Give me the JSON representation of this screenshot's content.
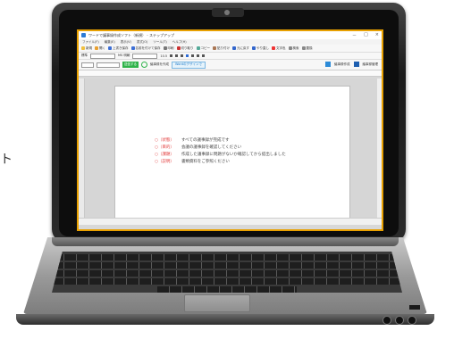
{
  "side_text": "ト",
  "app": {
    "title": "ワードで議事録作成ソフト（新規） - ステップアップ",
    "window_controls": [
      "－",
      "□",
      "×"
    ],
    "menu": [
      "ファイル(F)",
      "編集(E)",
      "表示(V)",
      "書式(O)",
      "ツール(T)",
      "ヘルプ(H)"
    ],
    "toolbar": [
      "新規",
      "開く",
      "上書き保存",
      "名前を付けて保存",
      "印刷",
      "切り取り",
      "コピー",
      "貼り付け",
      "元に戻す",
      "やり直し",
      "文字色",
      "検索",
      "置換"
    ],
    "style_label": "標準",
    "font_label": "MS 明朝",
    "font_size": "10.5",
    "green_button": "送信する",
    "ring_label": "議事録を作成",
    "design_button": "Wordのデザインで",
    "right_tools": [
      "議事録作成",
      "議事録管理"
    ]
  },
  "document": {
    "lines": [
      {
        "tag": "○（状態）",
        "text": "すべての議事録が完成です"
      },
      {
        "tag": "○（目的）",
        "text": "会議の議事録を確認してください"
      },
      {
        "tag": "○（課題）",
        "text": "作成した議事録に問題がないか確認してから提出しました"
      },
      {
        "tag": "○（説明）",
        "text": "書類資料をご参照ください"
      }
    ]
  }
}
